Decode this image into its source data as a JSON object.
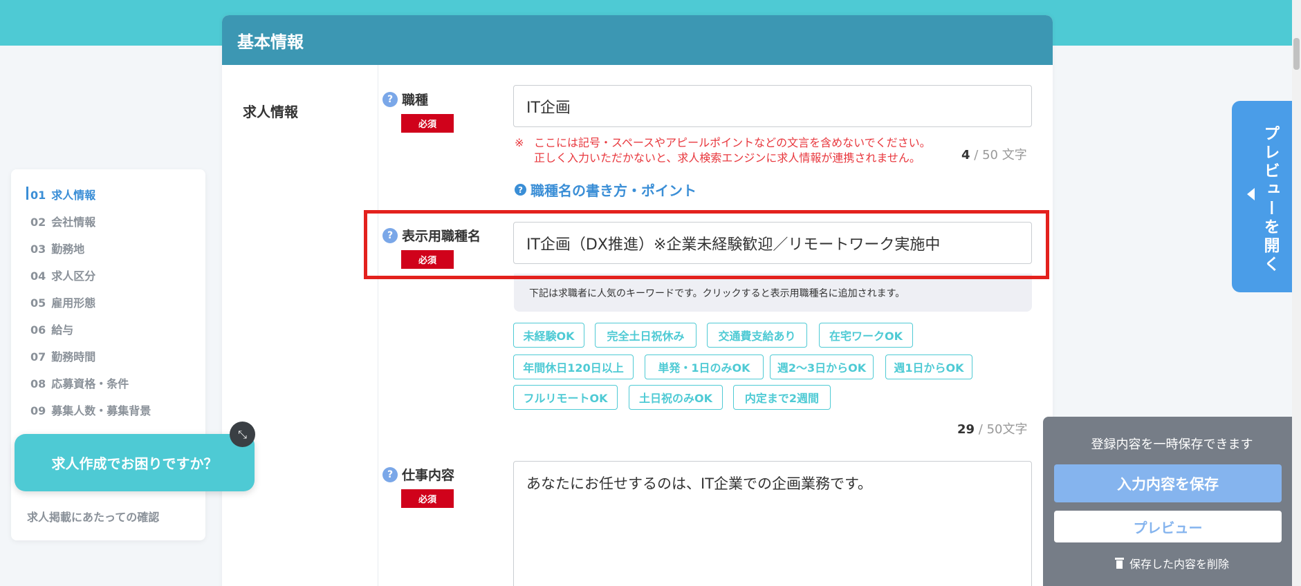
{
  "card": {
    "title": "基本情報"
  },
  "section": {
    "title": "求人情報"
  },
  "fields": {
    "job_type": {
      "label": "職種",
      "required": "必須",
      "value": "IT企画",
      "warning_mark": "※",
      "warning_line1": "ここには記号・スペースやアピールポイントなどの文言を含めないでください。",
      "warning_line2": "正しく入力いただかないと、求人検索エンジンに求人情報が連携されません。",
      "count": "4",
      "count_sep": "/",
      "count_max": "50 文字",
      "howto_link": "職種名の書き方・ポイント"
    },
    "display_title": {
      "label": "表示用職種名",
      "required": "必須",
      "value": "IT企画（DX推進）※企業未経験歓迎／リモートワーク実施中",
      "keyword_note": "下記は求職者に人気のキーワードです。クリックすると表示用職種名に追加されます。",
      "count": "29",
      "count_sep": "/",
      "count_max": "50文字"
    },
    "job_description": {
      "label": "仕事内容",
      "required": "必須",
      "value": "あなたにお任せするのは、IT企業での企画業務です。"
    }
  },
  "keywords": [
    "未経験OK",
    "完全土日祝休み",
    "交通費支給あり",
    "在宅ワークOK",
    "年間休日120日以上",
    "単発・1日のみOK",
    "週2〜3日からOK",
    "週1日からOK",
    "フルリモートOK",
    "土日祝のみOK",
    "内定まで2週間"
  ],
  "sidebar": {
    "items": [
      {
        "num": "01",
        "label": "求人情報"
      },
      {
        "num": "02",
        "label": "会社情報"
      },
      {
        "num": "03",
        "label": "勤務地"
      },
      {
        "num": "04",
        "label": "求人区分"
      },
      {
        "num": "05",
        "label": "雇用形態"
      },
      {
        "num": "06",
        "label": "給与"
      },
      {
        "num": "07",
        "label": "勤務時間"
      },
      {
        "num": "08",
        "label": "応募資格・条件"
      },
      {
        "num": "09",
        "label": "募集人数・募集背景"
      }
    ],
    "confirm": "求人掲載にあたっての確認"
  },
  "help": {
    "bubble": "求人作成でお困りですか？"
  },
  "preview_tab": {
    "label": "プレビューを開く"
  },
  "save_panel": {
    "note": "登録内容を一時保存できます",
    "save_button": "入力内容を保存",
    "preview_button": "プレビュー",
    "delete_link": "保存した内容を削除"
  },
  "colors": {
    "header": "#3c97b3",
    "accent_teal": "#4ecad4",
    "link_blue": "#3a8ed6",
    "required_red": "#d0021b",
    "highlight_red": "#e3211d"
  }
}
